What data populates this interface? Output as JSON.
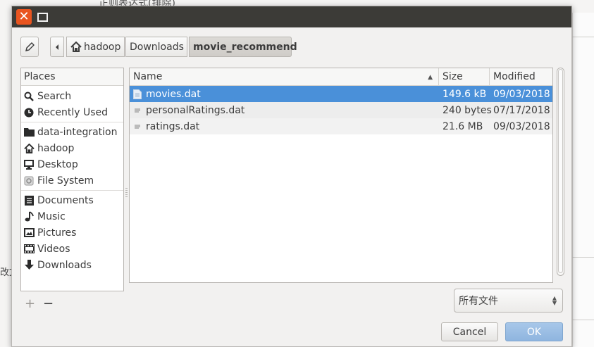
{
  "background": {
    "top_text": "正则表达式(排除)",
    "left_text": "改文"
  },
  "titlebar": {
    "close_symbol": "✕",
    "accent_color": "#e9541f"
  },
  "pathbar": {
    "crumbs": [
      "hadoop",
      "Downloads",
      "movie_recommend"
    ]
  },
  "places": {
    "header": "Places",
    "items": [
      {
        "label": "Search",
        "icon": "search-icon"
      },
      {
        "label": "Recently Used",
        "icon": "clock-icon"
      },
      {
        "label": "data-integration",
        "icon": "folder-icon"
      },
      {
        "label": "hadoop",
        "icon": "home-icon"
      },
      {
        "label": "Desktop",
        "icon": "monitor-icon"
      },
      {
        "label": "File System",
        "icon": "drive-icon"
      },
      {
        "label": "Documents",
        "icon": "document-icon"
      },
      {
        "label": "Music",
        "icon": "music-icon"
      },
      {
        "label": "Pictures",
        "icon": "picture-icon"
      },
      {
        "label": "Videos",
        "icon": "film-icon"
      },
      {
        "label": "Downloads",
        "icon": "download-icon"
      }
    ],
    "add_label": "+",
    "remove_label": "−"
  },
  "files": {
    "columns": {
      "name": "Name",
      "size": "Size",
      "modified": "Modified"
    },
    "rows": [
      {
        "name": "movies.dat",
        "size": "149.6 kB",
        "modified": "09/03/2018"
      },
      {
        "name": "personalRatings.dat",
        "size": "240 bytes",
        "modified": "07/17/2018"
      },
      {
        "name": "ratings.dat",
        "size": "21.6 MB",
        "modified": "09/03/2018"
      }
    ],
    "selection_color": "#4a90d9"
  },
  "filter": {
    "selected": "所有文件"
  },
  "buttons": {
    "cancel": "Cancel",
    "ok": "OK"
  }
}
